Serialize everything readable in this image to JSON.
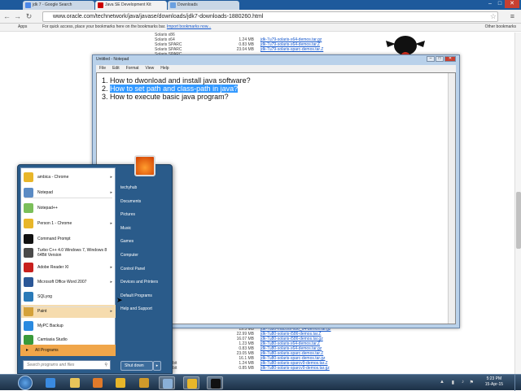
{
  "browser": {
    "tabs": [
      {
        "label": "jdk 7 - Google Search",
        "active": false
      },
      {
        "label": "Java SE Development Kit",
        "active": true
      },
      {
        "label": "Downloads",
        "active": false
      }
    ],
    "url": "www.oracle.com/technetwork/java/javase/downloads/jdk7-downloads-1880260.html",
    "bookmarks": {
      "apps": "Apps",
      "hint": "For quick access, place your bookmarks here on the bookmarks bar.",
      "import": "Import bookmarks now...",
      "other": "Other bookmarks"
    }
  },
  "page": {
    "top_rows": [
      {
        "os": "Solaris x86",
        "size": "",
        "file": ""
      },
      {
        "os": "Solaris x64",
        "size": "1.24 MB",
        "file": "jdk-7u79-solaris-x64-demos.tar.gz"
      },
      {
        "os": "Solaris SPARC",
        "size": "0.83 MB",
        "file": "jdk-7u79-solaris-x64-demos.tar.Z"
      },
      {
        "os": "Solaris SPARC",
        "size": "23.04 MB",
        "file": "jdk-7u79-solaris-sparc-demos.tar.Z"
      },
      {
        "os": "Solaris SPARC",
        "size": "",
        "file": ""
      }
    ],
    "bottom_rows": [
      {
        "os": "x86",
        "size": "19.5 MB",
        "file": "jdk-7u80-macosx-x86_64-demos.tar.gz"
      },
      {
        "os": "86",
        "size": "22.99 MB",
        "file": "jdk-7u80-solaris-i586-demos.tar.Z"
      },
      {
        "os": "86",
        "size": "16.07 MB",
        "file": "jdk-7u80-solaris-i586-demos.tar.gz"
      },
      {
        "os": "64",
        "size": "1.23 MB",
        "file": "jdk-7u80-solaris-x64-demos.tar.Z"
      },
      {
        "os": "64",
        "size": "0.83 MB",
        "file": "jdk-7u80-solaris-x64-demos.tar.gz"
      },
      {
        "os": "PARC",
        "size": "23.05 MB",
        "file": "jdk-7u80-solaris-sparc-demos.tar.Z"
      },
      {
        "os": "PARC",
        "size": "16.1 MB",
        "file": "jdk-7u80-solaris-sparc-demos.tar.gz"
      },
      {
        "os": "PARC 64-bit",
        "size": "1.24 MB",
        "file": "jdk-7u80-solaris-sparcv9-demos.tar.Z"
      },
      {
        "os": "PARC 64-bit",
        "size": "0.85 MB",
        "file": "jdk-7u80-solaris-sparcv9-demos.tar.gz"
      }
    ]
  },
  "notepad": {
    "title": "Untitled - Notepad",
    "menu": [
      "File",
      "Edit",
      "Format",
      "View",
      "Help"
    ],
    "lines": [
      {
        "num": "1.",
        "text": "How to dwonload and install java software?",
        "selected": false
      },
      {
        "num": "2.",
        "text": "How to set path and class-path in java?",
        "selected": true
      },
      {
        "num": "3.",
        "text": "How to execute basic java program?",
        "selected": false
      }
    ]
  },
  "startmenu": {
    "pinned": [
      {
        "label": "ambica - Chrome",
        "icon": "chrome-icon",
        "color": "#e8b62a",
        "arrow": true
      },
      {
        "label": "Notepad",
        "icon": "notepad-icon",
        "color": "#5b8bc4",
        "arrow": true
      },
      {
        "label": "Notepad++",
        "icon": "notepadpp-icon",
        "color": "#7bbf5a",
        "arrow": false
      },
      {
        "label": "Person 1 - Chrome",
        "icon": "chrome-icon",
        "color": "#e8b62a",
        "arrow": true
      },
      {
        "label": "Command Prompt",
        "icon": "cmd-icon",
        "color": "#111111",
        "arrow": false
      },
      {
        "label": "Turbo C++ 4.0 Windows 7, Windows 8 64Bit Version",
        "icon": "turbo-icon",
        "color": "#4a4a4a",
        "arrow": false
      },
      {
        "label": "Adobe Reader XI",
        "icon": "adobe-icon",
        "color": "#c8201e",
        "arrow": true
      },
      {
        "label": "Microsoft Office Word 2007",
        "icon": "word-icon",
        "color": "#2b5797",
        "arrow": true
      },
      {
        "label": "SQLyog",
        "icon": "sqlyog-icon",
        "color": "#2a7ab8",
        "arrow": false
      },
      {
        "label": "Paint",
        "icon": "paint-icon",
        "color": "#d4a13a",
        "arrow": true
      },
      {
        "label": "MyPC Backup",
        "icon": "backup-icon",
        "color": "#2a8ae0",
        "arrow": false
      },
      {
        "label": "Camtasia Studio",
        "icon": "camtasia-icon",
        "color": "#3a9a3a",
        "arrow": false
      }
    ],
    "all_programs": "All Programs",
    "search_placeholder": "Search programs and files",
    "right_items": [
      "techyhub",
      "Documents",
      "Pictures",
      "Music",
      "Games",
      "Computer",
      "Control Panel",
      "Devices and Printers",
      "Default Programs",
      "Help and Support"
    ],
    "shutdown": "Shut down"
  },
  "taskbar": {
    "time": "5:23 PM",
    "date": "15-Apr-15",
    "apps": [
      {
        "name": "ie-icon",
        "color": "#3a8ae0"
      },
      {
        "name": "explorer-icon",
        "color": "#e8c45a"
      },
      {
        "name": "media-player-icon",
        "color": "#e07a2a"
      },
      {
        "name": "chrome-icon",
        "color": "#e8b62a"
      },
      {
        "name": "mypc-icon",
        "color": "#d09a2a"
      },
      {
        "name": "notepad-icon",
        "color": "#8ab0d8"
      },
      {
        "name": "chrome-icon",
        "color": "#e8b62a"
      },
      {
        "name": "cmd-icon",
        "color": "#111111"
      }
    ]
  }
}
